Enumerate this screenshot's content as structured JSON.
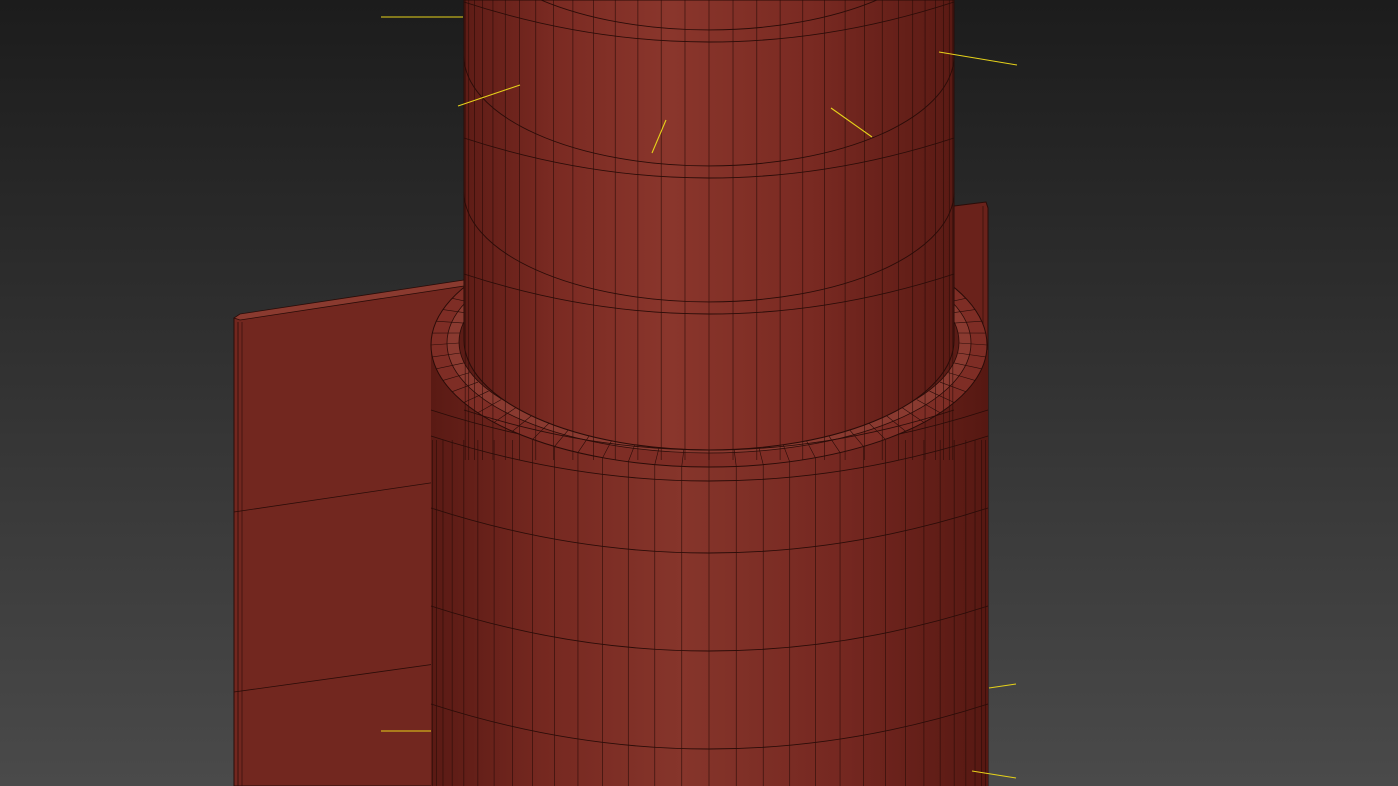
{
  "viewport": {
    "background_top": "#1c1c1c",
    "background_bottom": "#4a4a4a"
  },
  "model": {
    "base_color": "#7a2a22",
    "highlight_color": "#8e3a30",
    "shadow_color": "#5a1a15",
    "wire_color": "#2a0c08"
  },
  "normals": {
    "color": "#e6d21a"
  }
}
